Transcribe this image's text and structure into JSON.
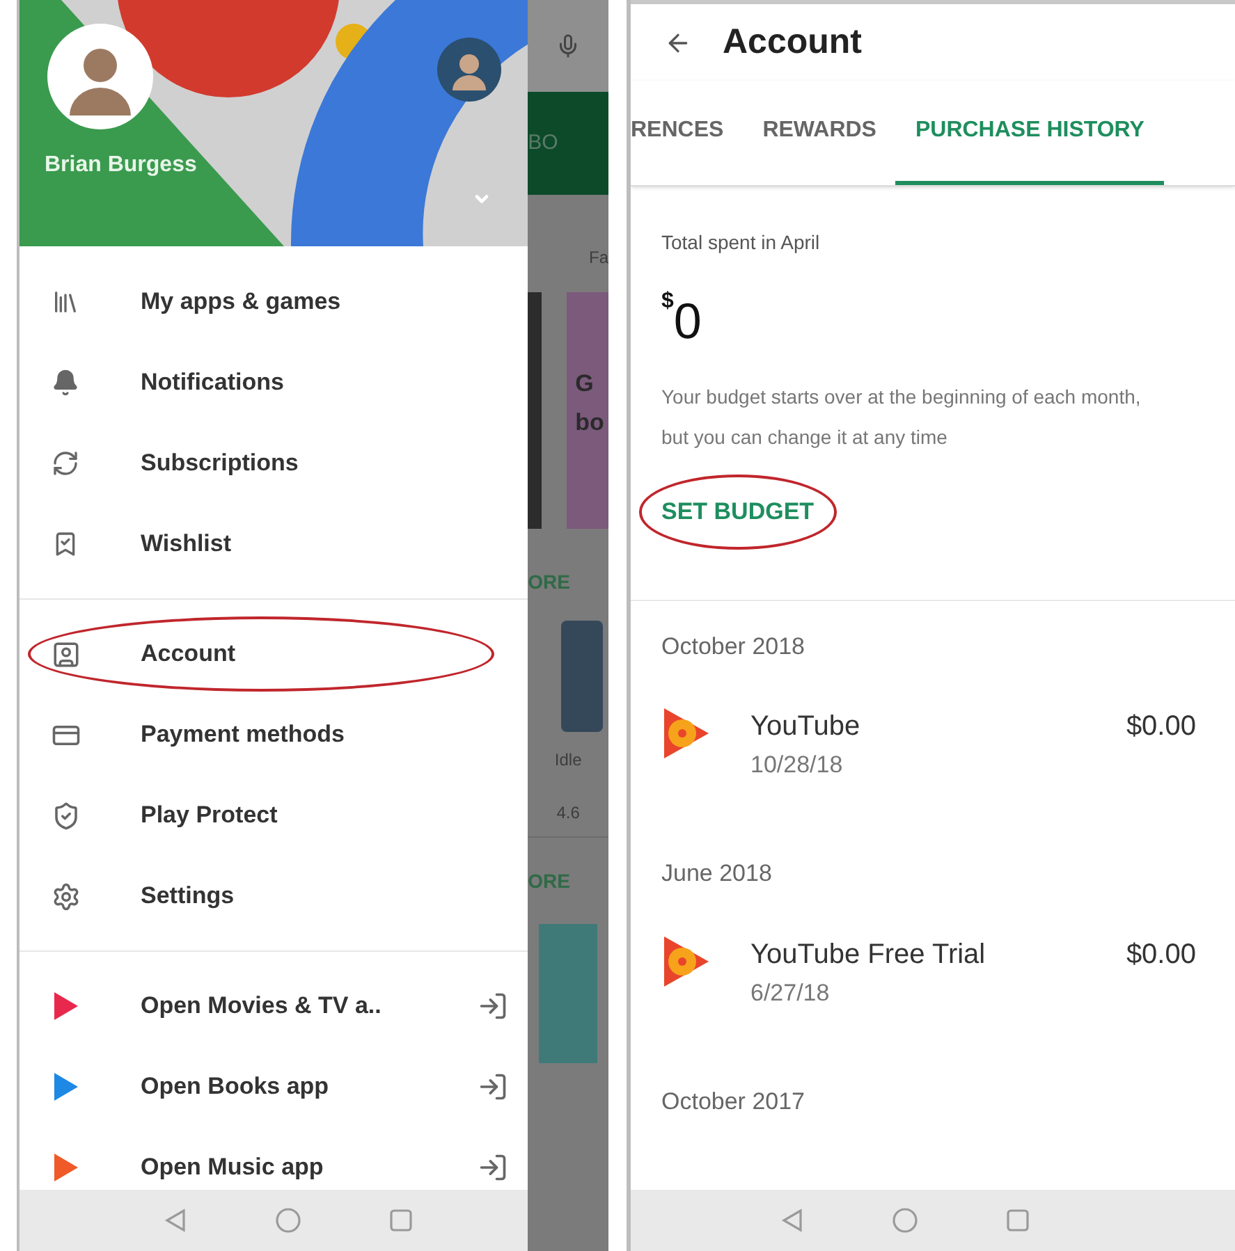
{
  "drawer": {
    "user_name": "Brian Burgess",
    "main_items": [
      {
        "label": "My apps & games"
      },
      {
        "label": "Notifications"
      },
      {
        "label": "Subscriptions"
      },
      {
        "label": "Wishlist"
      }
    ],
    "account_items": [
      {
        "label": "Account",
        "circled": true
      },
      {
        "label": "Payment methods",
        "circled": false
      },
      {
        "label": "Play Protect",
        "circled": false
      },
      {
        "label": "Settings",
        "circled": false
      }
    ],
    "app_links": [
      {
        "label": "Open Movies & TV a..",
        "color": "#e8284d"
      },
      {
        "label": "Open Books app",
        "color": "#1e88e5"
      },
      {
        "label": "Open Music app",
        "color": "#ef5a28"
      }
    ]
  },
  "background_peek": {
    "tab_fragment": "BO",
    "icon_caption": "Fa",
    "card_line_1": "G",
    "card_line_2": "bo",
    "more_1": "ORE",
    "app_name": "Idle",
    "rating": "4.6",
    "more_2": "ORE"
  },
  "account": {
    "title": "Account",
    "tabs": [
      {
        "label": "RENCES",
        "selected": false
      },
      {
        "label": "REWARDS",
        "selected": false
      },
      {
        "label": "PURCHASE HISTORY",
        "selected": true
      }
    ],
    "total_label": "Total spent in April",
    "currency": "$",
    "amount": "0",
    "budget_note": "Your budget starts over at the beginning of each month, but you can change it at any time",
    "set_budget": {
      "label": "SET BUDGET",
      "circled": true
    },
    "history": [
      {
        "month": "October 2018",
        "purchases": [
          {
            "name": "YouTube",
            "date": "10/28/18",
            "price": "$0.00"
          }
        ]
      },
      {
        "month": "June 2018",
        "purchases": [
          {
            "name": "YouTube Free Trial",
            "date": "6/27/18",
            "price": "$0.00"
          }
        ]
      },
      {
        "month": "October 2017"
      }
    ]
  }
}
